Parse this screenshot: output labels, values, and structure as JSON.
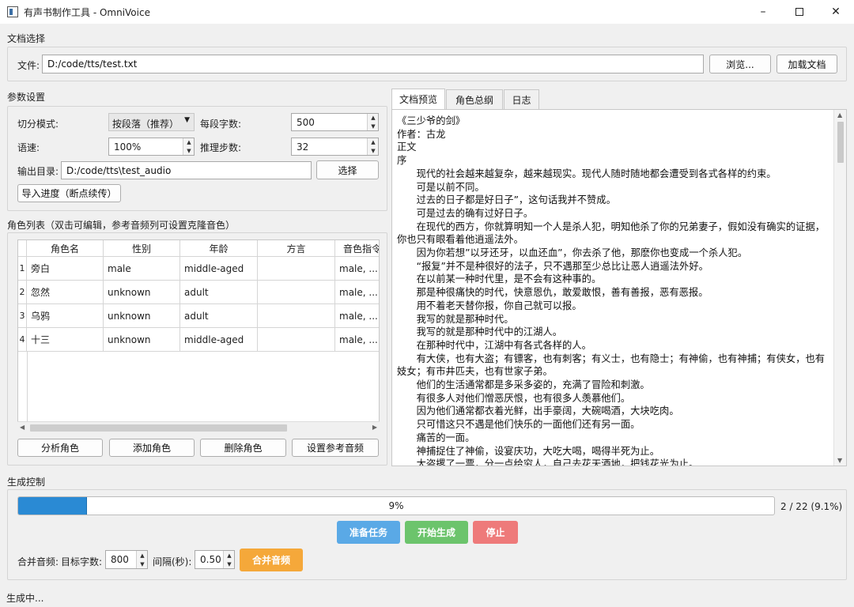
{
  "window": {
    "title": "有声书制作工具 - OmniVoice"
  },
  "document_section": {
    "title": "文档选择",
    "file_label": "文件:",
    "file_value": "D:/code/tts/test.txt",
    "browse_label": "浏览...",
    "load_label": "加载文档"
  },
  "params": {
    "title": "参数设置",
    "split_mode_label": "切分模式:",
    "split_mode_value": "按段落（推荐）",
    "chars_per_seg_label": "每段字数:",
    "chars_per_seg_value": "500",
    "speed_label": "语速:",
    "speed_value": "100%",
    "infer_steps_label": "推理步数:",
    "infer_steps_value": "32",
    "output_dir_label": "输出目录:",
    "output_dir_value": "D:/code/tts\\test_audio",
    "choose_label": "选择",
    "import_progress_label": "导入进度（断点续传）"
  },
  "roles": {
    "title": "角色列表（双击可编辑，参考音频列可设置克隆音色）",
    "columns": [
      "角色名",
      "性别",
      "年龄",
      "方言",
      "音色指令"
    ],
    "rows": [
      {
        "num": "1",
        "name": "旁白",
        "gender": "male",
        "age": "middle-aged",
        "dialect": "",
        "voice": "male, ..."
      },
      {
        "num": "2",
        "name": "忽然",
        "gender": "unknown",
        "age": "adult",
        "dialect": "",
        "voice": "male, ..."
      },
      {
        "num": "3",
        "name": "乌鸦",
        "gender": "unknown",
        "age": "adult",
        "dialect": "",
        "voice": "male, ..."
      },
      {
        "num": "4",
        "name": "十三",
        "gender": "unknown",
        "age": "middle-aged",
        "dialect": "",
        "voice": "male, ..."
      }
    ],
    "buttons": {
      "analyze": "分析角色",
      "add": "添加角色",
      "delete": "删除角色",
      "set_ref": "设置参考音频"
    }
  },
  "tabs": [
    {
      "label": "文档预览",
      "active": true
    },
    {
      "label": "角色总纲",
      "active": false
    },
    {
      "label": "日志",
      "active": false
    }
  ],
  "preview_lines": [
    "《三少爷的剑》",
    "作者：古龙",
    "正文",
    "序",
    "　　现代的社会越来越复杂，越来越现实。现代人随时随地都会遭受到各式各样的约束。",
    "　　可是以前不同。",
    "　　过去的日子都是好日子”，这句话我并不赞成。",
    "　　可是过去的确有过好日子。",
    "　　在现代的西方，你就算明知一个人是杀人犯，明知他杀了你的兄弟妻子，假如没有确实的证据，你也只有眼看着他逍遥法外。",
    "　　因为你若想”以牙还牙，以血还血”，你去杀了他，那麽你也变成一个杀人犯。",
    "　　“报复”并不是种很好的法子，只不遇那至少总比让恶人逍遥法外好。",
    "　　在以前某一种时代里，是不会有这种事的。",
    "　　那是种很痛快的时代，快意恩仇，敢爱敢恨，善有善报，恶有恶报。",
    "　　用不着老天替你报，你自己就可以报。",
    "　　我写的就是那种时代。",
    "　　我写的就是那种时代中的江湖人。",
    "　　在那种时代中，江湖中有各式各样的人。",
    "　　有大侠，也有大盗；有镖客，也有刺客；有义士，也有隐士；有神偷，也有神捕；有侠女，也有妓女；有市井匹夫，也有世家子弟。",
    "　　他们的生活通常都是多采多姿的，充满了冒险和刺激。",
    "　　有很多人对他们憎恶厌恨，也有很多人羡慕他们。",
    "　　因为他们通常都衣着光鲜，出手豪阔，大碗喝酒，大块吃肉。",
    "　　只可惜这只不遇是他们快乐的一面他们还有另一面。",
    "　　痛苦的一面。",
    "　　神捕捉住了神偷，设宴庆功，大吃大喝，喝得半死为止。",
    "　　大盗撂了一票，分一点给穷人，自己去花天酒地，把钱花光为止。"
  ],
  "generation": {
    "title": "生成控制",
    "progress_value": 0.091,
    "progress_text": "9%",
    "progress_count": "2 / 22 (9.1%)",
    "prepare_label": "准备任务",
    "start_label": "开始生成",
    "stop_label": "停止",
    "merge_label": "合并音频:",
    "target_chars_label": "目标字数:",
    "target_chars_value": "800",
    "interval_label": "间隔(秒):",
    "interval_value": "0.50",
    "merge_button": "合并音频"
  },
  "status_bar": "生成中...",
  "colors": {
    "progress": "#2a8ad4",
    "prepare": "#5aa9e6",
    "start": "#6cc46c",
    "stop": "#ee7a7a",
    "merge": "#f5a83a"
  }
}
